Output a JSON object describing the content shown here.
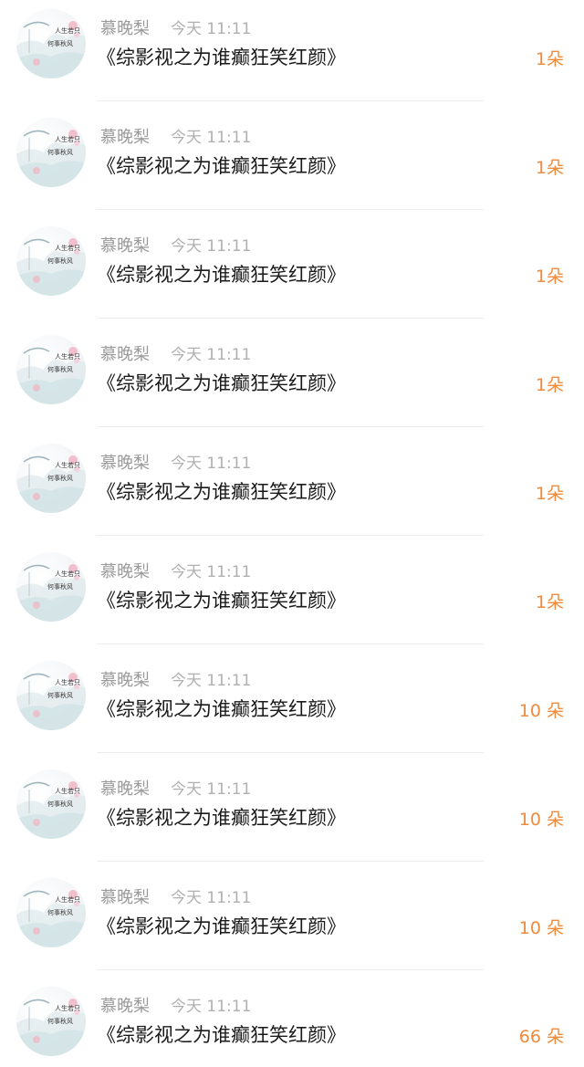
{
  "colors": {
    "count": "#f08a3c",
    "username": "#9a9a9a",
    "time": "#b0b0b0",
    "title": "#1a1a1a"
  },
  "items": [
    {
      "user": "慕晚梨",
      "time": "今天 11:11",
      "title": "《综影视之为谁癫狂笑红颜》",
      "count": "1朵",
      "avatar_icon": "ink-painting-avatar"
    },
    {
      "user": "慕晚梨",
      "time": "今天 11:11",
      "title": "《综影视之为谁癫狂笑红颜》",
      "count": "1朵",
      "avatar_icon": "ink-painting-avatar"
    },
    {
      "user": "慕晚梨",
      "time": "今天 11:11",
      "title": "《综影视之为谁癫狂笑红颜》",
      "count": "1朵",
      "avatar_icon": "ink-painting-avatar"
    },
    {
      "user": "慕晚梨",
      "time": "今天 11:11",
      "title": "《综影视之为谁癫狂笑红颜》",
      "count": "1朵",
      "avatar_icon": "ink-painting-avatar"
    },
    {
      "user": "慕晚梨",
      "time": "今天 11:11",
      "title": "《综影视之为谁癫狂笑红颜》",
      "count": "1朵",
      "avatar_icon": "ink-painting-avatar"
    },
    {
      "user": "慕晚梨",
      "time": "今天 11:11",
      "title": "《综影视之为谁癫狂笑红颜》",
      "count": "1朵",
      "avatar_icon": "ink-painting-avatar"
    },
    {
      "user": "慕晚梨",
      "time": "今天 11:11",
      "title": "《综影视之为谁癫狂笑红颜》",
      "count": "10 朵",
      "avatar_icon": "ink-painting-avatar"
    },
    {
      "user": "慕晚梨",
      "time": "今天 11:11",
      "title": "《综影视之为谁癫狂笑红颜》",
      "count": "10 朵",
      "avatar_icon": "ink-painting-avatar"
    },
    {
      "user": "慕晚梨",
      "time": "今天 11:11",
      "title": "《综影视之为谁癫狂笑红颜》",
      "count": "10 朵",
      "avatar_icon": "ink-painting-avatar"
    },
    {
      "user": "慕晚梨",
      "time": "今天 11:11",
      "title": "《综影视之为谁癫狂笑红颜》",
      "count": "66 朵",
      "avatar_icon": "ink-painting-avatar"
    }
  ]
}
